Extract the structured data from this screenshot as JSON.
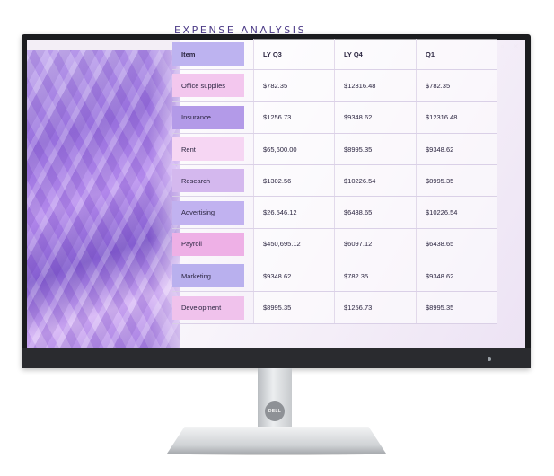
{
  "window": {
    "controls": [
      "–",
      "▫",
      "✕"
    ]
  },
  "app": {
    "title": "EXPENSE ANALYSIS"
  },
  "table": {
    "headers": [
      "Item",
      "LY Q3",
      "LY Q4",
      "Q1"
    ],
    "rows": [
      {
        "item": "Office supplies",
        "ly_q3": "$782.35",
        "ly_q4": "$12316.48",
        "q1": "$782.35",
        "chip": "#f3c7ee"
      },
      {
        "item": "Insurance",
        "ly_q3": "$1256.73",
        "ly_q4": "$9348.62",
        "q1": "$12316.48",
        "chip": "#b39ae8"
      },
      {
        "item": "Rent",
        "ly_q3": "$65,600.00",
        "ly_q4": "$8995.35",
        "q1": "$9348.62",
        "chip": "#f6d6f3"
      },
      {
        "item": "Research",
        "ly_q3": "$1302.56",
        "ly_q4": "$10226.54",
        "q1": "$8995.35",
        "chip": "#d4b8ee"
      },
      {
        "item": "Advertising",
        "ly_q3": "$26.546.12",
        "ly_q4": "$6438.65",
        "q1": "$10226.54",
        "chip": "#c1b2f0"
      },
      {
        "item": "Payroll",
        "ly_q3": "$450,695.12",
        "ly_q4": "$6097.12",
        "q1": "$6438.65",
        "chip": "#eeb0e6"
      },
      {
        "item": "Marketing",
        "ly_q3": "$9348.62",
        "ly_q4": "$782.35",
        "q1": "$9348.62",
        "chip": "#b9b0ee"
      },
      {
        "item": "Development",
        "ly_q3": "$8995.35",
        "ly_q4": "$1256.73",
        "q1": "$8995.35",
        "chip": "#f0c2ec"
      }
    ],
    "header_chip": "#bdb3f0"
  },
  "device": {
    "logo": "DELL"
  },
  "colors": {
    "title": "#4b3a86",
    "accent": "#8d6ad8"
  }
}
